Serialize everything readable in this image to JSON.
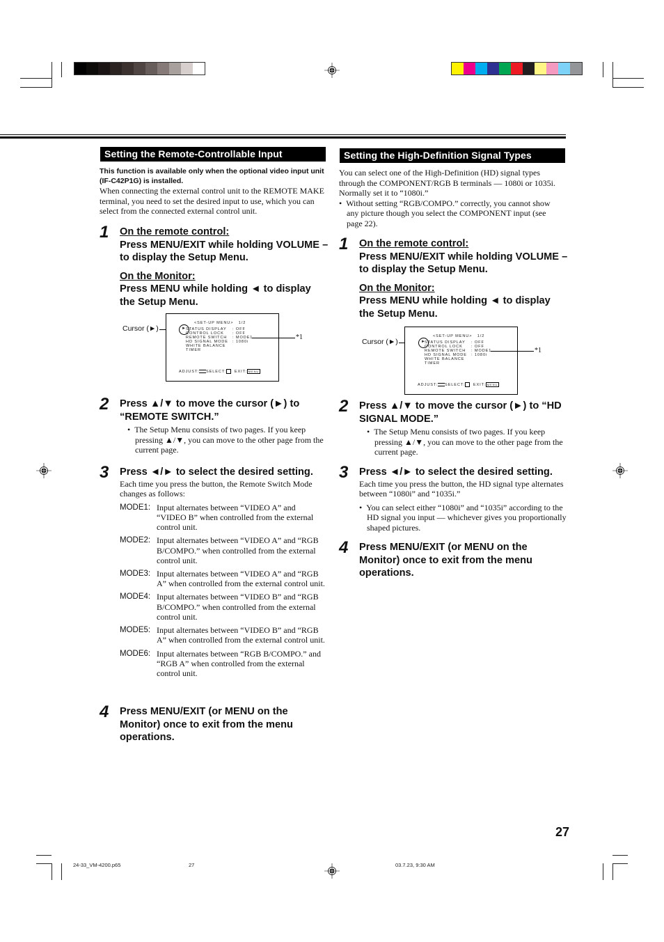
{
  "print_marks": {
    "gray_bars": [
      "#000000",
      "#0d0a0a",
      "#1a1514",
      "#2a2321",
      "#3b3230",
      "#4f4542",
      "#675d5a",
      "#857a77",
      "#a7a09d",
      "#d6cfcd",
      "#ffffff"
    ],
    "color_bars": [
      "#fff200",
      "#ec008c",
      "#00aeef",
      "#2e3192",
      "#00a651",
      "#ed1c24",
      "#231f20",
      "#fff685",
      "#f49ac1",
      "#7dd3f7",
      "#939598"
    ]
  },
  "left": {
    "section_title": "Setting the Remote-Controllable Input",
    "note_bold": "This function is available only when the optional video input unit (IF-C42P1G) is installed.",
    "intro": "When connecting the external control unit to the REMOTE MAKE terminal, you need to set the desired input to use, which you can select from the connected external control unit.",
    "step1": {
      "num": "1",
      "remote_heading": "On the remote control:",
      "remote_text": "Press MENU/EXIT while holding VOLUME – to display the Setup Menu.",
      "monitor_heading": "On the Monitor:",
      "monitor_text": "Press MENU while holding ◄ to display the Setup Menu."
    },
    "menu": {
      "cursor_label": "Cursor (►)",
      "footnote": "*1",
      "title": "<SET-UP MENU>",
      "page": "1/2",
      "items": [
        {
          "label": "STATUS DISPLAY",
          "value": ": OFF"
        },
        {
          "label": "CONTROL LOCK",
          "value": ": OFF"
        },
        {
          "label": "REMOTE SWITCH",
          "value": ": MODE1"
        },
        {
          "label": "HD SIGNAL MODE",
          "value": ": 1080i"
        },
        {
          "label": "WHITE BALANCE",
          "value": ""
        },
        {
          "label": "TIMER",
          "value": ""
        }
      ],
      "adjust": "ADJUST:",
      "select": "SELECT:",
      "exit": "EXIT:",
      "exit_key": "MENU"
    },
    "step2": {
      "num": "2",
      "title": "Press ▲/▼ to move the cursor (►) to “REMOTE SWITCH.”",
      "bullet": "The Setup Menu consists of two pages. If you keep pressing ▲/▼, you can move to the other page from the current page."
    },
    "step3": {
      "num": "3",
      "title": "Press ◄/► to select the desired setting.",
      "text": "Each time you press the button, the Remote Switch Mode changes as follows:",
      "modes": [
        {
          "label": "MODE1:",
          "text": "Input alternates between “VIDEO A” and “VIDEO B” when controlled from the external control unit."
        },
        {
          "label": "MODE2:",
          "text": "Input alternates between “VIDEO A” and “RGB B/COMPO.” when controlled from the external control unit."
        },
        {
          "label": "MODE3:",
          "text": "Input alternates between “VIDEO A” and “RGB A” when controlled from the external control unit."
        },
        {
          "label": "MODE4:",
          "text": "Input alternates between “VIDEO B” and “RGB B/COMPO.” when controlled from the external control unit."
        },
        {
          "label": "MODE5:",
          "text": "Input alternates between “VIDEO B” and “RGB A” when controlled from the external control unit."
        },
        {
          "label": "MODE6:",
          "text": "Input alternates between “RGB B/COMPO.” and “RGB A” when controlled from the external control unit."
        }
      ]
    },
    "step4": {
      "num": "4",
      "title": "Press MENU/EXIT (or MENU on the Monitor) once to exit from the menu operations."
    }
  },
  "right": {
    "section_title": "Setting the High-Definition Signal Types",
    "intro": "You can select one of the High-Definition (HD) signal types through the COMPONENT/RGB B terminals — 1080i or 1035i. Normally set it to “1080i.”",
    "bullet": "Without setting “RGB/COMPO.” correctly, you cannot show any picture though you select the COMPONENT input (see page 22).",
    "step1": {
      "num": "1",
      "remote_heading": "On the remote control:",
      "remote_text": "Press MENU/EXIT while holding VOLUME – to display the Setup Menu.",
      "monitor_heading": "On the Monitor:",
      "monitor_text": "Press MENU while holding ◄ to display the Setup Menu."
    },
    "step2": {
      "num": "2",
      "title": "Press ▲/▼ to move the cursor (►) to “HD SIGNAL MODE.”",
      "bullet": "The Setup Menu consists of two pages. If you keep pressing ▲/▼, you can move to the other page from the current page."
    },
    "step3": {
      "num": "3",
      "title": "Press ◄/► to select the desired setting.",
      "text": "Each time you press the button, the HD signal type alternates between “1080i” and “1035i.”",
      "bullet": "You can select either “1080i” and “1035i” according to the HD signal you input — whichever gives you proportionally shaped pictures."
    },
    "step4": {
      "num": "4",
      "title": "Press MENU/EXIT (or MENU on the Monitor) once to exit from the menu operations."
    }
  },
  "footer": {
    "page_number": "27",
    "file_name": "24-33_VM-4200.p65",
    "page_ref": "27",
    "timestamp": "03.7.23, 9:30 AM"
  }
}
